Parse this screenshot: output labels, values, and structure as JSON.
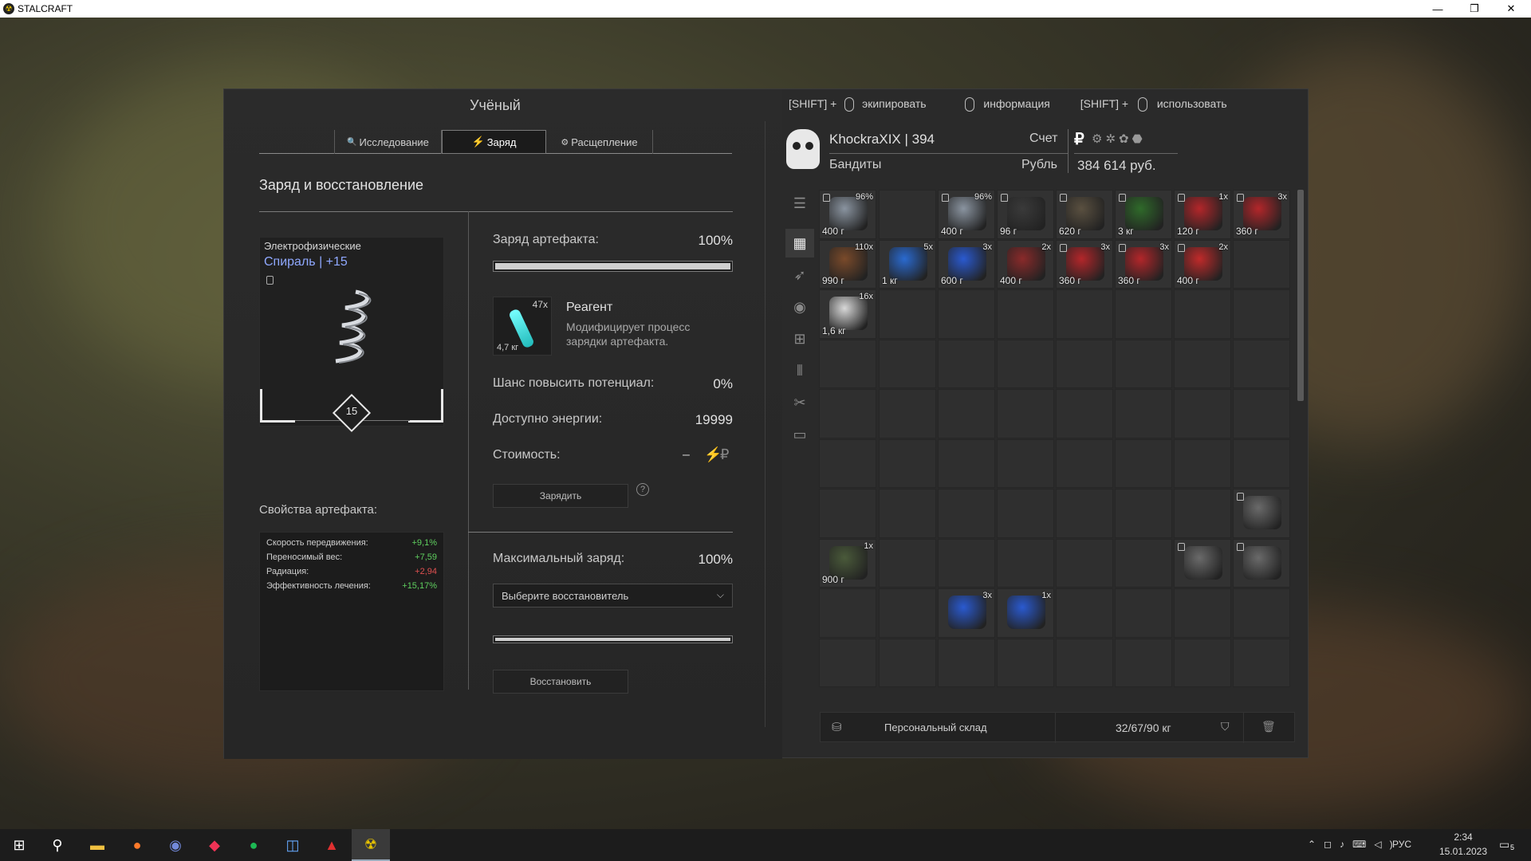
{
  "window": {
    "title": "STALCRAFT",
    "minimize": "—",
    "restore": "❐",
    "close": "✕"
  },
  "left": {
    "title": "Учёный",
    "tabs": [
      {
        "label": "",
        "icon": ""
      },
      {
        "label": "Исследование",
        "icon": "🔍"
      },
      {
        "label": "Заряд",
        "icon": "⚡"
      },
      {
        "label": "Расщепление",
        "icon": "⚙"
      },
      {
        "label": "",
        "icon": ""
      }
    ],
    "section_title": "Заряд и восстановление",
    "artifact": {
      "category": "Электрофизические",
      "name": "Спираль | +15",
      "level": "15"
    },
    "charge_label": "Заряд артефакта:",
    "charge_value": "100%",
    "charge_fraction": 1.0,
    "reagent": {
      "name": "Реагент",
      "count": "47x",
      "weight": "4,7 кг",
      "desc_line1": "Модифицирует процесс",
      "desc_line2": "зарядки артефакта."
    },
    "chance_label": "Шанс повысить потенциал:",
    "chance_value": "0%",
    "energy_label": "Доступно энергии:",
    "energy_value": "19999",
    "cost_label": "Стоимость:",
    "cost_value": "–",
    "charge_button": "Зарядить",
    "help": "?",
    "props_title": "Свойства артефакта:",
    "props": [
      {
        "name": "Скорость передвижения:",
        "value": "+9,1%",
        "color": "#5fcf5f"
      },
      {
        "name": "Переносимый вес:",
        "value": "+7,59",
        "color": "#5fcf5f"
      },
      {
        "name": "Радиация:",
        "value": "+2,94",
        "color": "#e05050"
      },
      {
        "name": "Эффективность лечения:",
        "value": "+15,17%",
        "color": "#5fcf5f"
      }
    ],
    "max_charge_label": "Максимальный заряд:",
    "max_charge_value": "100%",
    "max_charge_fraction": 1.0,
    "restorer_placeholder": "Выберите восстановитель",
    "restore_button": "Восстановить"
  },
  "hints": {
    "shift1": "[SHIFT] +",
    "equip": "экипировать",
    "info": "информация",
    "shift2": "[SHIFT] +",
    "use": "использовать"
  },
  "player": {
    "name": "KhockraXIX | 394",
    "faction": "Бандиты",
    "account_label": "Счет",
    "currency_label": "Рубль",
    "balance": "384 614 руб.",
    "currency_symbol": "₽"
  },
  "inventory": {
    "cells": [
      {
        "row": 0,
        "col": 0,
        "weight": "400 г",
        "count": "96%",
        "lock": true,
        "color": "#8a94a0"
      },
      {
        "row": 0,
        "col": 2,
        "weight": "400 г",
        "count": "96%",
        "lock": true,
        "color": "#8a94a0"
      },
      {
        "row": 0,
        "col": 3,
        "weight": "96 г",
        "count": "",
        "lock": true,
        "color": "#3a3a3a"
      },
      {
        "row": 0,
        "col": 4,
        "weight": "620 г",
        "count": "",
        "lock": true,
        "color": "#5a5040"
      },
      {
        "row": 0,
        "col": 5,
        "weight": "3 кг",
        "count": "",
        "lock": true,
        "color": "#2f6a2a"
      },
      {
        "row": 0,
        "col": 6,
        "weight": "120 г",
        "count": "1x",
        "lock": true,
        "color": "#b3262a"
      },
      {
        "row": 0,
        "col": 7,
        "weight": "360 г",
        "count": "3x",
        "lock": true,
        "color": "#b3262a"
      },
      {
        "row": 1,
        "col": 0,
        "weight": "990 г",
        "count": "110x",
        "lock": false,
        "color": "#7a4a2a"
      },
      {
        "row": 1,
        "col": 1,
        "weight": "1 кг",
        "count": "5x",
        "lock": false,
        "color": "#2a6ad0"
      },
      {
        "row": 1,
        "col": 2,
        "weight": "600 г",
        "count": "3x",
        "lock": false,
        "color": "#2a5ad0"
      },
      {
        "row": 1,
        "col": 3,
        "weight": "400 г",
        "count": "2x",
        "lock": false,
        "color": "#8a2a2a"
      },
      {
        "row": 1,
        "col": 4,
        "weight": "360 г",
        "count": "3x",
        "lock": true,
        "color": "#b3262a"
      },
      {
        "row": 1,
        "col": 5,
        "weight": "360 г",
        "count": "3x",
        "lock": true,
        "color": "#b3262a"
      },
      {
        "row": 1,
        "col": 6,
        "weight": "400 г",
        "count": "2x",
        "lock": true,
        "color": "#c02a2a"
      },
      {
        "row": 2,
        "col": 0,
        "weight": "1,6 кг",
        "count": "16x",
        "lock": false,
        "color": "#d8d8d8"
      },
      {
        "row": 6,
        "col": 7,
        "weight": "",
        "count": "",
        "lock": true,
        "color": "#6a6a6a"
      },
      {
        "row": 7,
        "col": 0,
        "weight": "900 г",
        "count": "1x",
        "lock": false,
        "color": "#4a5a3a"
      },
      {
        "row": 7,
        "col": 6,
        "weight": "",
        "count": "",
        "lock": true,
        "color": "#6a6a6a"
      },
      {
        "row": 7,
        "col": 7,
        "weight": "",
        "count": "",
        "lock": true,
        "color": "#6a6a6a"
      },
      {
        "row": 8,
        "col": 2,
        "weight": "",
        "count": "3x",
        "lock": false,
        "color": "#2a5ad0"
      },
      {
        "row": 8,
        "col": 3,
        "weight": "",
        "count": "1x",
        "lock": false,
        "color": "#2a5ad0"
      }
    ],
    "storage_label": "Персональный склад",
    "weight_status": "32/67/90 кг"
  },
  "taskbar": {
    "time": "2:34",
    "date": "15.01.2023",
    "lang": "РУС",
    "notif": "5"
  }
}
